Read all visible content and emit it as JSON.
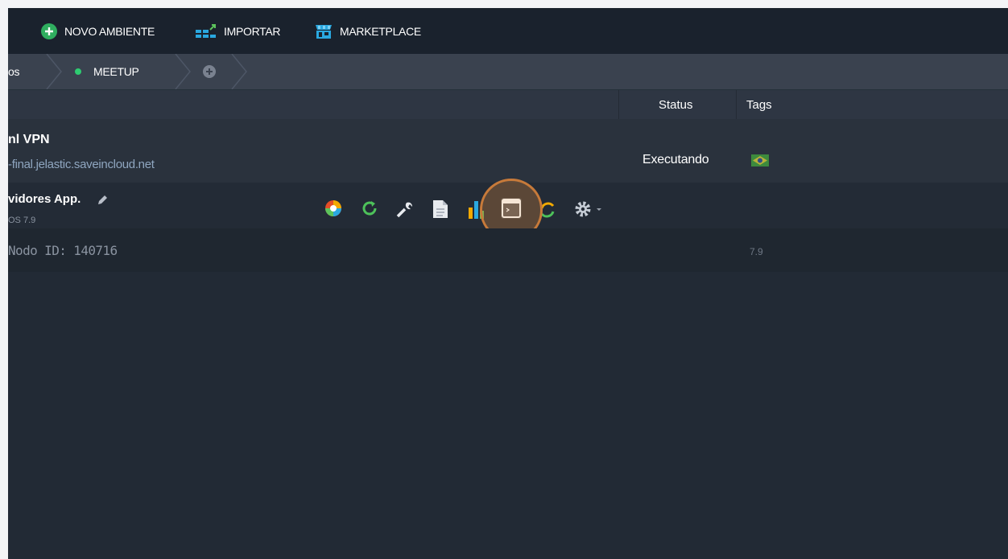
{
  "toolbar": {
    "new_env": "NOVO AMBIENTE",
    "import": "IMPORTAR",
    "marketplace": "MARKETPLACE"
  },
  "tabs": {
    "partial": "os",
    "active": "MEETUP"
  },
  "table": {
    "col_status": "Status",
    "col_tags": "Tags"
  },
  "env": {
    "name": "nl VPN",
    "domain": "-final.jelastic.saveincloud.net",
    "status": "Executando"
  },
  "node_group": {
    "name": "vidores App.",
    "os": "OS 7.9"
  },
  "node": {
    "id": "Nodo ID: 140716",
    "version": "7.9"
  },
  "colors": {
    "accent": "#c77a3a",
    "status_green": "#2ecc71"
  },
  "icons": [
    "add-circle-icon",
    "import-icon",
    "marketplace-icon",
    "add-tab-icon",
    "brazil-flag-icon",
    "config-icon",
    "restart-icon",
    "wrench-icon",
    "file-icon",
    "stats-icon",
    "terminal-icon",
    "redeploy-icon",
    "gear-icon"
  ]
}
